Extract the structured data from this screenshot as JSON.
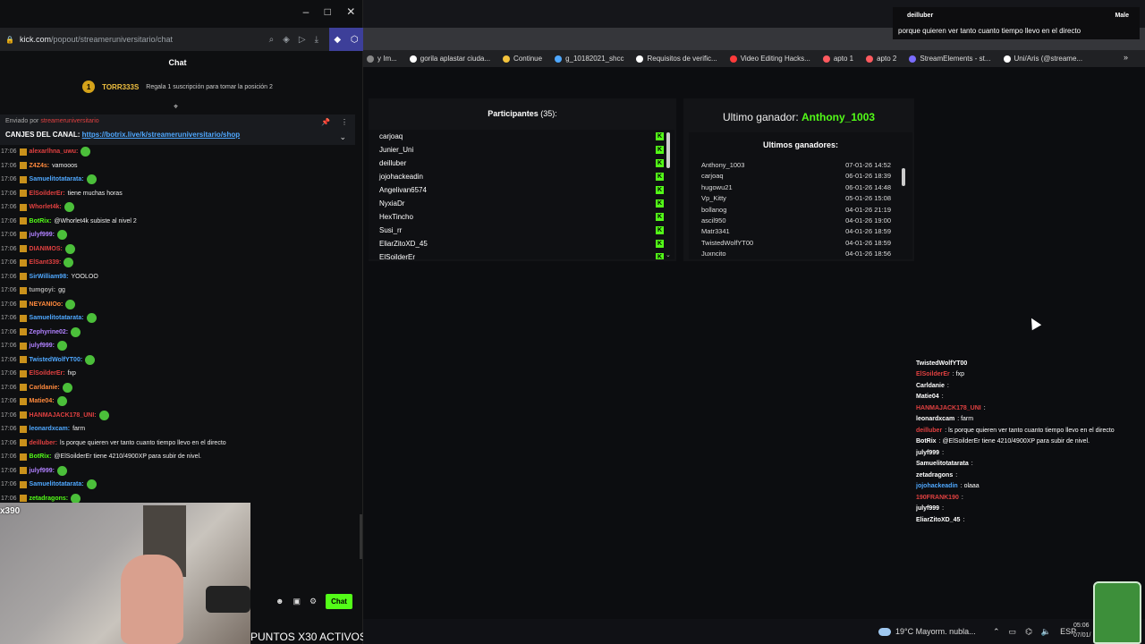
{
  "popout": {
    "url_host": "kick.com",
    "url_path": "/popout/streameruniversitario/chat",
    "chat_title": "Chat",
    "sub_user": "TORR333S",
    "sub_text": "Regala 1 suscripción para tomar la posición 2",
    "pinned_by": "Enviado por",
    "pinned_text": "CANJES DEL CANAL:",
    "pinned_link": "https://botrix.live/k/streameruniversitario/shop",
    "send_label": "Chat"
  },
  "chat_messages": [
    {
      "time": "17:06",
      "user": "alexarlhna_uwu",
      "color": "#e04040",
      "text": ""
    },
    {
      "time": "17:06",
      "user": "Z4Z4s",
      "color": "#ff8a3d",
      "text": "vamooos"
    },
    {
      "time": "17:06",
      "user": "Samuelitotatarata",
      "color": "#4fa8ff",
      "text": ""
    },
    {
      "time": "17:06",
      "user": "ElSoilderEr",
      "color": "#e04040",
      "text": "tiene muchas horas"
    },
    {
      "time": "17:06",
      "user": "Whorlet4k",
      "color": "#e04040",
      "text": ""
    },
    {
      "time": "17:06",
      "user": "BotRix",
      "color": "#53fc18",
      "text": "@Whorlet4k subiste al nivel 2"
    },
    {
      "time": "17:06",
      "user": "julyf999",
      "color": "#b080ff",
      "text": ""
    },
    {
      "time": "17:06",
      "user": "DIANIMOS",
      "color": "#e04040",
      "text": ""
    },
    {
      "time": "17:06",
      "user": "ElSant339",
      "color": "#e04040",
      "text": ""
    },
    {
      "time": "17:06",
      "user": "SirWilliam98",
      "color": "#4fa8ff",
      "text": "YOOLOO"
    },
    {
      "time": "17:06",
      "user": "tumgoyi",
      "color": "#aaaaaa",
      "text": "gg"
    },
    {
      "time": "17:06",
      "user": "NEYANIOo",
      "color": "#ff8a3d",
      "text": ""
    },
    {
      "time": "17:06",
      "user": "Samuelitotatarata",
      "color": "#4fa8ff",
      "text": ""
    },
    {
      "time": "17:06",
      "user": "Zephyrine02",
      "color": "#b080ff",
      "text": ""
    },
    {
      "time": "17:06",
      "user": "julyf999",
      "color": "#b080ff",
      "text": ""
    },
    {
      "time": "17:06",
      "user": "TwistedWolfYT00",
      "color": "#4fa8ff",
      "text": ""
    },
    {
      "time": "17:06",
      "user": "ElSoilderEr",
      "color": "#e04040",
      "text": "fxp"
    },
    {
      "time": "17:06",
      "user": "Carldanie",
      "color": "#ff8a3d",
      "text": ""
    },
    {
      "time": "17:06",
      "user": "Matie04",
      "color": "#ff8a3d",
      "text": ""
    },
    {
      "time": "17:06",
      "user": "HANMAJACK178_UNI",
      "color": "#e04040",
      "text": ""
    },
    {
      "time": "17:06",
      "user": "leonardxcam",
      "color": "#4fa8ff",
      "text": "farm"
    },
    {
      "time": "17:06",
      "user": "deilluber",
      "color": "#e04040",
      "text": "ls porque quieren ver tanto cuanto tiempo llevo en el directo"
    },
    {
      "time": "17:06",
      "user": "BotRix",
      "color": "#53fc18",
      "text": "@ElSoilderEr tiene 4210/4900XP para subir de nivel."
    },
    {
      "time": "17:06",
      "user": "julyf999",
      "color": "#b080ff",
      "text": ""
    },
    {
      "time": "17:06",
      "user": "Samuelitotatarata",
      "color": "#4fa8ff",
      "text": ""
    },
    {
      "time": "17:06",
      "user": "zetadragons",
      "color": "#53fc18",
      "text": ""
    }
  ],
  "webcam": {
    "label": "x390",
    "ticker": "PUNTOS X30 ACTIVOS"
  },
  "notification": {
    "user": "deilluber",
    "message": "porque quieren ver tanto cuanto tiempo llevo en el directo",
    "right": "Male"
  },
  "bookmarks": [
    {
      "label": "y Im...",
      "color": "#888"
    },
    {
      "label": "gorila aplastar ciuda...",
      "color": "#fff"
    },
    {
      "label": "Continue",
      "color": "#f3c33d"
    },
    {
      "label": "g_10182021_shcc",
      "color": "#4fa8ff"
    },
    {
      "label": "Requisitos de verific...",
      "color": "#fff"
    },
    {
      "label": "Video Editing Hacks...",
      "color": "#ff3b3b"
    },
    {
      "label": "apto 1",
      "color": "#ff5a5f"
    },
    {
      "label": "apto 2",
      "color": "#ff5a5f"
    },
    {
      "label": "StreamElements - st...",
      "color": "#7a6cff"
    },
    {
      "label": "Uni/Aris (@streame...",
      "color": "#fff"
    }
  ],
  "participants": {
    "title": "Participantes",
    "count": "(35):",
    "list": [
      "carjoaq",
      "Junier_Uni",
      "deilluber",
      "jojohackeadin",
      "Angelivan6574",
      "NyxiaDr",
      "HexTincho",
      "Susi_rr",
      "EliarZitoXD_45",
      "ElSoilderEr"
    ]
  },
  "winners": {
    "last_label": "Ultimo ganador:",
    "last_name": "Anthony_1003",
    "header": "Ultimos ganadores:",
    "list": [
      {
        "name": "Anthony_1003",
        "date": "07-01-26 14:52"
      },
      {
        "name": "carjoaq",
        "date": "06-01-26 18:39"
      },
      {
        "name": "hugowu21",
        "date": "06-01-26 14:48"
      },
      {
        "name": "Vp_Kitty",
        "date": "05-01-26 15:08"
      },
      {
        "name": "bollanog",
        "date": "04-01-26 21:19"
      },
      {
        "name": "ascil950",
        "date": "04-01-26 19:00"
      },
      {
        "name": "Matr3341",
        "date": "04-01-26 18:59"
      },
      {
        "name": "TwistedWolfYT00",
        "date": "04-01-26 18:59"
      },
      {
        "name": "Juxncito",
        "date": "04-01-26 18:56"
      }
    ]
  },
  "overlay_chat": [
    {
      "user": "TwistedWolfYT00",
      "color": "#ffffff",
      "text": ""
    },
    {
      "user": "ElSoilderEr",
      "color": "#e04040",
      "text": ": fxp"
    },
    {
      "user": "Carldanie",
      "color": "#ffffff",
      "text": ":"
    },
    {
      "user": "Matie04",
      "color": "#ffffff",
      "text": ":"
    },
    {
      "user": "HANMAJACK178_UNI",
      "color": "#e04040",
      "text": ":"
    },
    {
      "user": "leonardxcam",
      "color": "#ffffff",
      "text": ": farm"
    },
    {
      "user": "deilluber",
      "color": "#e04040",
      "text": ": ls porque quieren ver tanto cuanto tiempo llevo en el directo"
    },
    {
      "user": "BotRix",
      "color": "#ffffff",
      "text": ": @ElSoilderEr tiene 4210/4900XP para subir de nivel."
    },
    {
      "user": "julyf999",
      "color": "#ffffff",
      "text": ":"
    },
    {
      "user": "Samuelitotatarata",
      "color": "#ffffff",
      "text": ":"
    },
    {
      "user": "zetadragons",
      "color": "#ffffff",
      "text": ":"
    },
    {
      "user": "jojohackeadin",
      "color": "#4fa8ff",
      "text": ": olaaa"
    },
    {
      "user": "190FRANK190",
      "color": "#e04040",
      "text": ":"
    },
    {
      "user": "julyf999",
      "color": "#ffffff",
      "text": ":"
    },
    {
      "user": "EliarZitoXD_45",
      "color": "#ffffff",
      "text": ":"
    }
  ],
  "taskbar": {
    "weather": "19°C  Mayorm. nubla...",
    "lang": "ESP",
    "time": "05:06",
    "date": "07/01/"
  }
}
